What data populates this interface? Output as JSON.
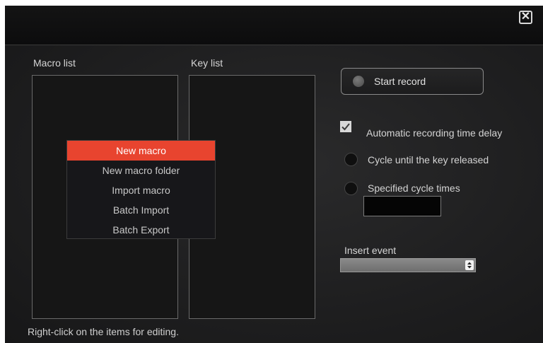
{
  "window": {
    "close_icon": "close-icon"
  },
  "macro_list": {
    "label": "Macro list"
  },
  "key_list": {
    "label": "Key list"
  },
  "context_menu": {
    "items": [
      {
        "label": "New macro",
        "highlighted": true
      },
      {
        "label": "New macro folder"
      },
      {
        "label": "Import macro"
      },
      {
        "label": "Batch Import"
      },
      {
        "label": "Batch Export"
      }
    ],
    "highlight_color": "#e8442f"
  },
  "record": {
    "label": "Start record"
  },
  "options": {
    "auto_delay": {
      "label": "Automatic recording time delay",
      "checked": true
    },
    "cycle_until_release": {
      "label": "Cycle until the key released",
      "selected": false
    },
    "specified_cycles": {
      "label": "Specified cycle times",
      "selected": false,
      "value": ""
    }
  },
  "insert_event": {
    "label": "Insert event",
    "value": ""
  },
  "footer": {
    "hint": "Right-click on the items for editing."
  }
}
